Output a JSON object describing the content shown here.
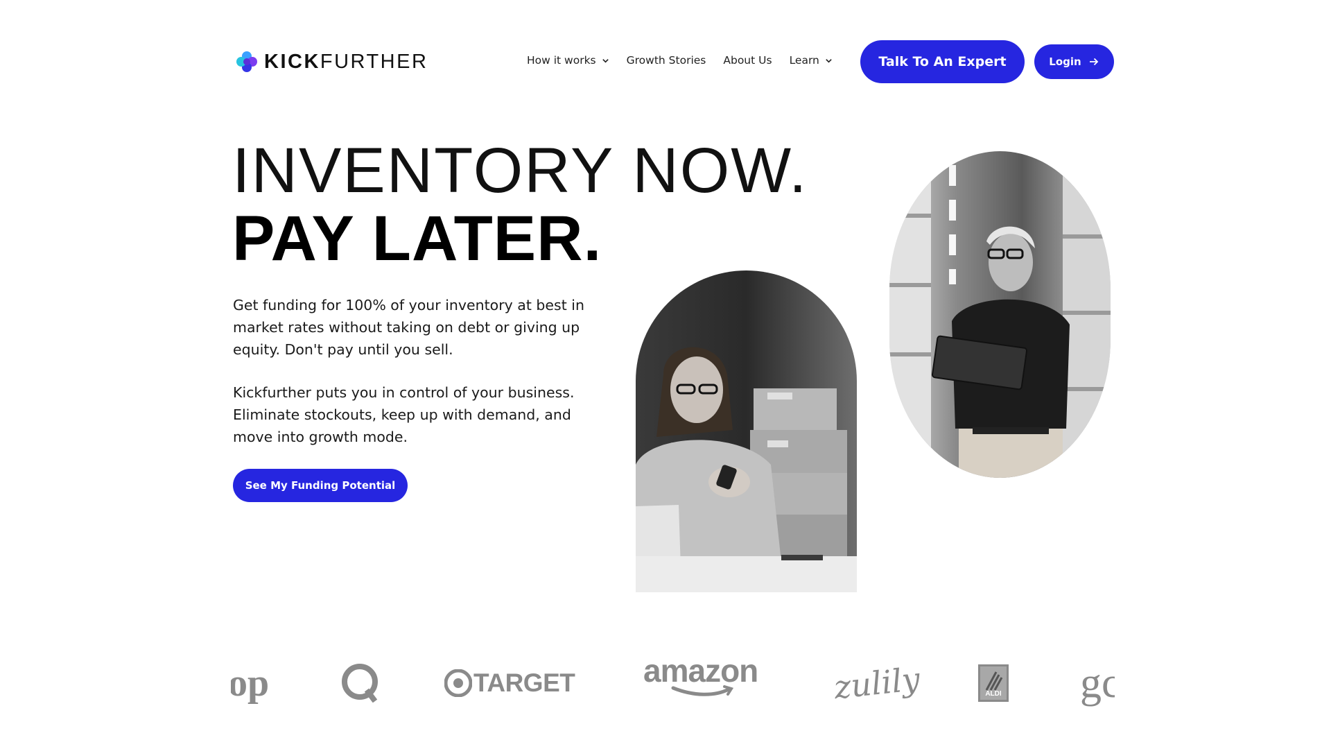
{
  "header": {
    "logo_bold": "KICK",
    "logo_light": "FURTHER",
    "nav": [
      {
        "label": "How it works",
        "has_dropdown": true
      },
      {
        "label": "Growth Stories",
        "has_dropdown": false
      },
      {
        "label": "About Us",
        "has_dropdown": false
      },
      {
        "label": "Learn",
        "has_dropdown": true
      }
    ],
    "cta_label": "Talk To An Expert",
    "login_label": "Login"
  },
  "hero": {
    "headline_line1": "INVENTORY NOW.",
    "headline_line2": "PAY LATER.",
    "paragraph1": "Get funding for 100% of your inventory at best in market rates without taking on debt or giving up equity. Don't pay until you sell.",
    "paragraph2": "Kickfurther puts you in control of your business. Eliminate stockouts, keep up with demand, and move into growth mode.",
    "cta_label": "See My Funding Potential"
  },
  "logos": {
    "partial_left": "op",
    "qvc": "QVC",
    "target": "TARGET",
    "amazon": "amazon",
    "zulily": "zulily",
    "aldi": "ALDI",
    "partial_right": "gc"
  },
  "colors": {
    "accent": "#2626e0",
    "text": "#111111",
    "logo_gray": "#8a8a8a",
    "background": "#ffffff"
  },
  "icons": {
    "chevron": "chevron-down-icon",
    "login_arrow": "arrow-right-icon",
    "logo_mark": "kickfurther-flower-icon"
  }
}
